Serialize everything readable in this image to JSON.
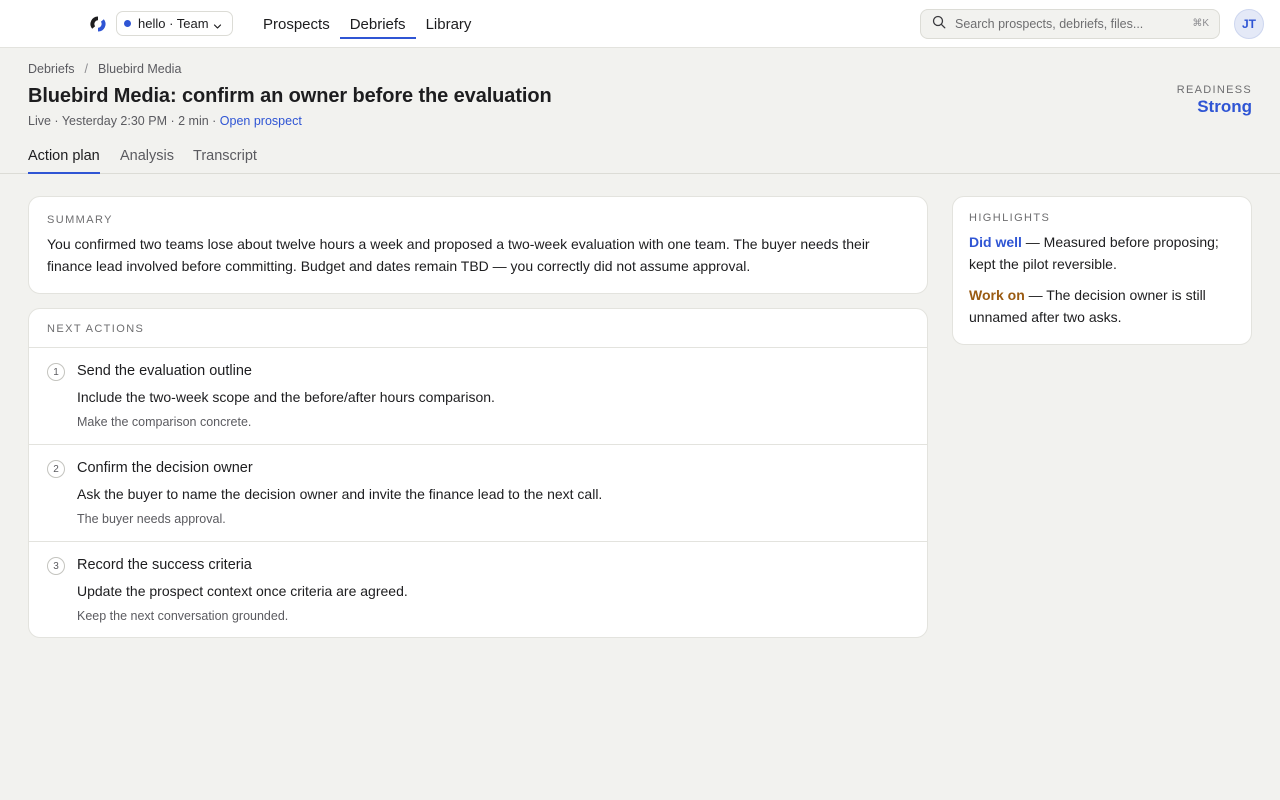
{
  "colors": {
    "accent": "#2f55d4",
    "work_on": "#9a5b12",
    "background": "#f2f2ef",
    "card": "#ffffff"
  },
  "topbar": {
    "logo_icon": "brand-logo-icon",
    "workspace": {
      "label": "hello · Team",
      "dot_color": "#2f55d4",
      "chevron_icon": "chevron-down-icon"
    },
    "nav": [
      {
        "label": "Prospects",
        "active": false
      },
      {
        "label": "Debriefs",
        "active": true
      },
      {
        "label": "Library",
        "active": false
      }
    ],
    "search": {
      "placeholder": "Search prospects, debriefs, files...",
      "shortcut": "⌘K",
      "icon": "search-icon"
    },
    "avatar_initials": "JT"
  },
  "breadcrumb": {
    "root": "Debriefs",
    "separator": "/",
    "current": "Bluebird Media"
  },
  "page": {
    "title": "Bluebird Media: confirm an owner before the evaluation",
    "meta": {
      "status": "Live",
      "time": "Yesterday 2:30 PM",
      "duration": "2 min",
      "separator": " · ",
      "link": "Open prospect"
    },
    "readiness": {
      "label": "READINESS",
      "value": "Strong"
    }
  },
  "tabs": [
    {
      "label": "Action plan",
      "active": true
    },
    {
      "label": "Analysis",
      "active": false
    },
    {
      "label": "Transcript",
      "active": false
    }
  ],
  "summary": {
    "heading": "SUMMARY",
    "text": "You confirmed two teams lose about twelve hours a week and proposed a two-week evaluation with one team. The buyer needs their finance lead involved before committing. Budget and dates remain TBD — you correctly did not assume approval."
  },
  "next_actions": {
    "heading": "NEXT ACTIONS",
    "items": [
      {
        "number": "1",
        "title": "Send the evaluation outline",
        "description": "Include the two-week scope and the before/after hours comparison.",
        "note": "Make the comparison concrete."
      },
      {
        "number": "2",
        "title": "Confirm the decision owner",
        "description": "Ask the buyer to name the decision owner and invite the finance lead to the next call.",
        "note": "The buyer needs approval."
      },
      {
        "number": "3",
        "title": "Record the success criteria",
        "description": "Update the prospect context once criteria are agreed.",
        "note": "Keep the next conversation grounded."
      }
    ]
  },
  "highlights": {
    "heading": "HIGHLIGHTS",
    "did_well": {
      "label": "Did well",
      "text": " — Measured before proposing; kept the pilot reversible."
    },
    "work_on": {
      "label": "Work on",
      "text": " — The decision owner is still unnamed after two asks."
    }
  }
}
